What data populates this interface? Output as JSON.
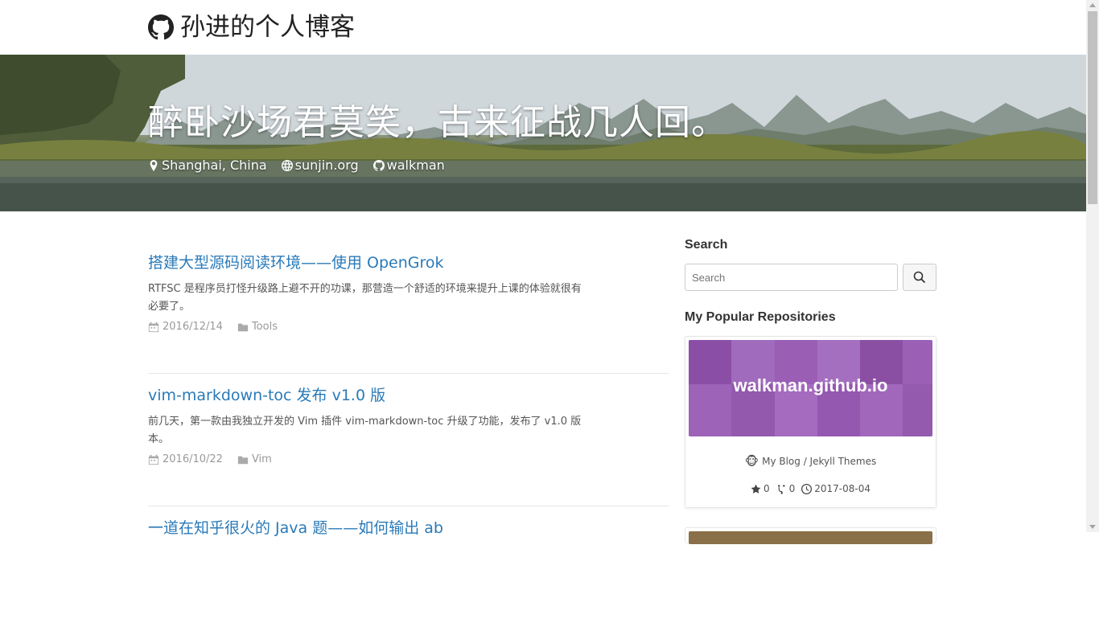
{
  "navbar": {
    "brand": "孙进的个人博客",
    "brand_icon": "github-icon"
  },
  "banner": {
    "title": "醉卧沙场君莫笑，古来征战几人回。",
    "location": "Shanghai, China",
    "website": "sunjin.org",
    "github": "walkman"
  },
  "posts": [
    {
      "title": "搭建大型源码阅读环境——使用 OpenGrok",
      "excerpt": "RTFSC 是程序员打怪升级路上避不开的功课，那营造一个舒适的环境来提升上课的体验就很有必要了。",
      "date": "2016/12/14",
      "category": "Tools"
    },
    {
      "title": "vim-markdown-toc 发布 v1.0 版",
      "excerpt": "前几天，第一款由我独立开发的 Vim 插件 vim-markdown-toc 升级了功能，发布了 v1.0 版本。",
      "date": "2016/10/22",
      "category": "Vim"
    },
    {
      "title": "一道在知乎很火的 Java 题——如何输出 ab",
      "excerpt": "",
      "date": "",
      "category": ""
    }
  ],
  "sidebar": {
    "search_heading": "Search",
    "search_placeholder": "Search",
    "repos_heading": "My Popular Repositories",
    "repo": {
      "name": "walkman.github.io",
      "description": "My Blog / Jekyll Themes",
      "stars": "0",
      "forks": "0",
      "updated": "2017-08-04"
    }
  }
}
